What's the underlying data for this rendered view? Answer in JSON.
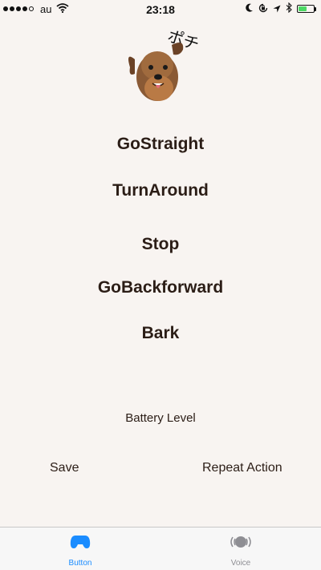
{
  "status_bar": {
    "carrier": "au",
    "time": "23:18",
    "battery_level": 0.55,
    "icons": [
      "signal-dots",
      "wifi-icon",
      "moon-icon",
      "rotation-lock-icon",
      "location-icon",
      "bluetooth-icon",
      "battery-icon"
    ]
  },
  "logo": {
    "text": "ポチ",
    "icon": "dog-face-icon"
  },
  "actions": [
    {
      "label": "GoStraight"
    },
    {
      "label": "TurnAround"
    },
    {
      "label": "Stop"
    },
    {
      "label": "GoBackforward"
    },
    {
      "label": "Bark"
    }
  ],
  "battery_level_label": "Battery Level",
  "bottom_actions": {
    "save_label": "Save",
    "repeat_label": "Repeat Action"
  },
  "tabs": [
    {
      "label": "Button",
      "icon": "gamepad-icon",
      "active": true
    },
    {
      "label": "Voice",
      "icon": "voice-icon",
      "active": false
    }
  ],
  "colors": {
    "background": "#f8f4f1",
    "text": "#2b1d16",
    "tab_active": "#1a8cff",
    "tab_inactive": "#8e8e93",
    "battery_fill": "#4cd964"
  }
}
